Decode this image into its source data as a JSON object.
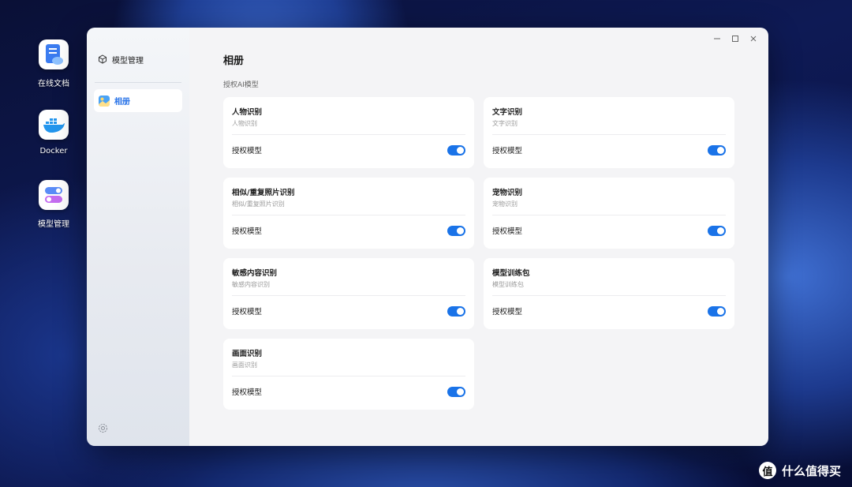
{
  "desktop": {
    "icons": [
      {
        "label": "在线文档",
        "icon": "document-cloud-icon"
      },
      {
        "label": "Docker",
        "icon": "docker-whale-icon"
      },
      {
        "label": "模型管理",
        "icon": "toggle-switches-icon"
      }
    ]
  },
  "sidebar": {
    "header_label": "模型管理",
    "items": [
      {
        "label": "相册",
        "active": true,
        "icon": "photo-album-icon"
      }
    ],
    "settings_icon": "gear-icon"
  },
  "window_controls": [
    "minimize-icon",
    "maximize-icon",
    "close-icon"
  ],
  "main": {
    "title": "相册",
    "section_label": "授权AI模型",
    "cards": [
      {
        "title": "人物识别",
        "subtitle": "人物识别",
        "row_label": "授权模型",
        "enabled": true
      },
      {
        "title": "文字识别",
        "subtitle": "文字识别",
        "row_label": "授权模型",
        "enabled": true
      },
      {
        "title": "相似/重复照片识别",
        "subtitle": "相似/重复照片识别",
        "row_label": "授权模型",
        "enabled": true
      },
      {
        "title": "宠物识别",
        "subtitle": "宠物识别",
        "row_label": "授权模型",
        "enabled": true
      },
      {
        "title": "敏感内容识别",
        "subtitle": "敏感内容识别",
        "row_label": "授权模型",
        "enabled": true
      },
      {
        "title": "模型训练包",
        "subtitle": "模型训练包",
        "row_label": "授权模型",
        "enabled": true
      },
      {
        "title": "画面识别",
        "subtitle": "画面识别",
        "row_label": "授权模型",
        "enabled": true
      }
    ]
  },
  "watermark": {
    "badge": "值",
    "text": "什么值得买"
  },
  "colors": {
    "accent": "#1a73e8",
    "active_text": "#2a74e8"
  }
}
